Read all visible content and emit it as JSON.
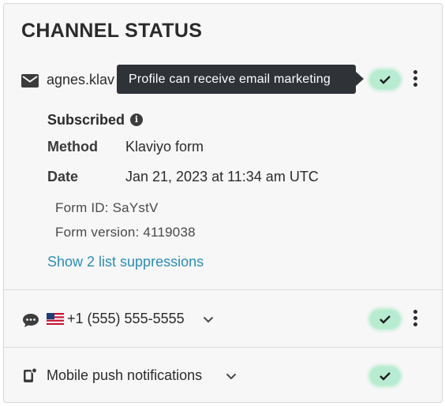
{
  "title": "CHANNEL STATUS",
  "email": {
    "address": "agnes.klav",
    "tooltip": "Profile can receive email marketing",
    "status": "Subscribed",
    "method_label": "Method",
    "method_value": "Klaviyo form",
    "date_label": "Date",
    "date_value": "Jan 21, 2023 at 11:34 am UTC",
    "form_id": "Form ID: SaYstV",
    "form_version": "Form version: 4119038",
    "suppressions_link": "Show 2 list suppressions"
  },
  "sms": {
    "phone": "+1 (555) 555-5555",
    "flag": "us-flag-icon"
  },
  "push": {
    "label": "Mobile push notifications"
  },
  "colors": {
    "accent_link": "#2a8db8",
    "badge_green": "#b8ecd0",
    "tooltip_bg": "#2f3338"
  },
  "icons": [
    "email-icon",
    "info-icon",
    "checkmark-icon",
    "kebab-menu-icon",
    "sms-chat-icon",
    "chevron-down-icon",
    "mobile-push-icon"
  ]
}
